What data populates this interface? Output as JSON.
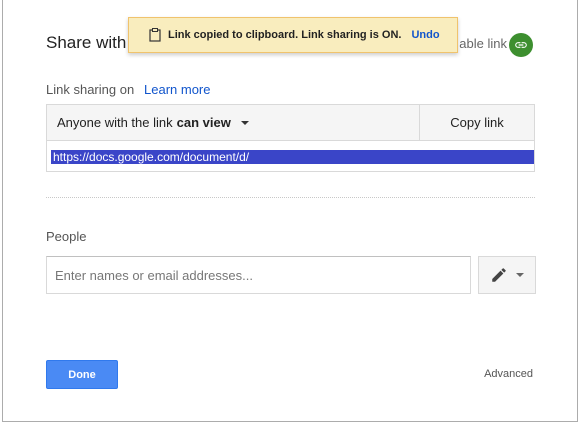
{
  "dialog": {
    "title": "Share with",
    "shareable_link_text": "able link",
    "link_icon": "link-icon"
  },
  "toast": {
    "message": "Link copied to clipboard. Link sharing is ON.",
    "undo_label": "Undo",
    "icon": "clipboard-icon",
    "background": "#f9edbe"
  },
  "link_sharing": {
    "label": "Link sharing on",
    "learn_more": "Learn more",
    "access_prefix": "Anyone with the link",
    "access_level": "can view",
    "copy_link_label": "Copy link",
    "url": "https://docs.google.com/document/d/"
  },
  "people": {
    "label": "People",
    "placeholder": "Enter names or email addresses...",
    "permission_icon": "pencil-icon"
  },
  "footer": {
    "done_label": "Done",
    "advanced_label": "Advanced",
    "done_color": "#4a8af4"
  },
  "colors": {
    "accent_link": "#1155cc",
    "selection": "#3a45c8",
    "link_icon_bg": "#3d8f2f"
  }
}
